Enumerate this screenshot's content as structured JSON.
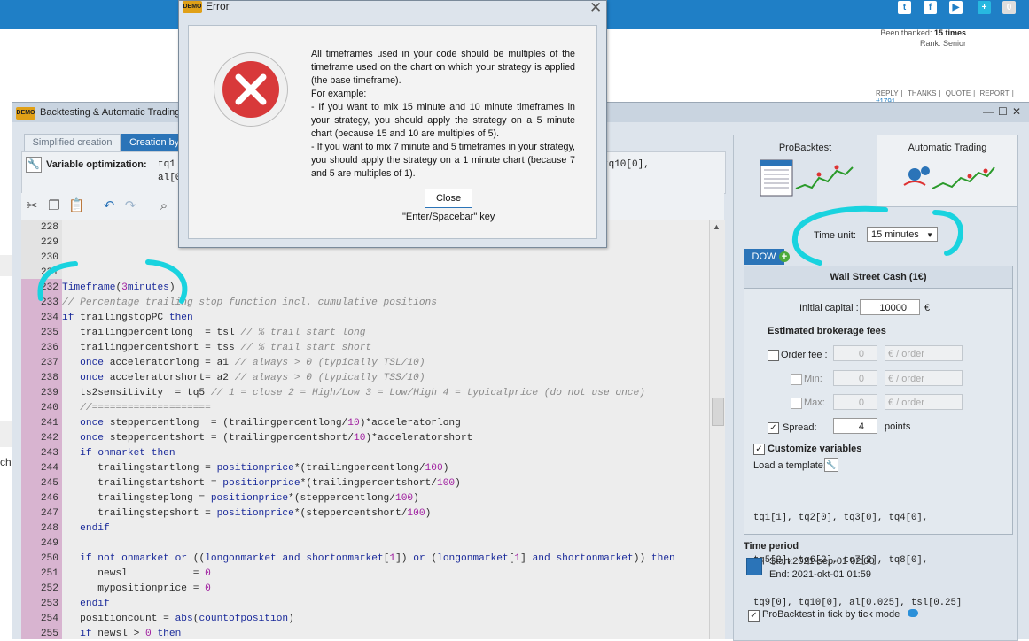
{
  "forum": {
    "been_thanked_label": "Been thanked:",
    "been_thanked_value": "15 times",
    "rank": "Rank: Senior",
    "actions": [
      "REPLY",
      "THANKS",
      "QUOTE",
      "REPORT"
    ],
    "post_id": "#1791",
    "side_text": "ch",
    "notification_count": "0"
  },
  "window": {
    "badge": "DEMO",
    "title": "Backtesting & Automatic Trading"
  },
  "tabs": {
    "simplified": "Simplified creation",
    "creation": "Creation by"
  },
  "var_opt": {
    "label": "Variable optimization:",
    "line1": "tq1",
    "line2": "al[0",
    "line1_tail": "tq10[0],"
  },
  "code_lines": [
    {
      "n": "228",
      "html": ""
    },
    {
      "n": "229",
      "html": ""
    },
    {
      "n": "230",
      "html": ""
    },
    {
      "n": "231",
      "html": ""
    },
    {
      "n": "232",
      "html": "<span class='f'>Timeframe</span>(<span class='n'>3</span><span class='k'>minutes</span>)"
    },
    {
      "n": "233",
      "html": "<span class='c'>// Percentage trailing stop function incl. cumulative positions</span>"
    },
    {
      "n": "234",
      "html": "<span class='k'>if</span> trailingstopPC <span class='k'>then</span>"
    },
    {
      "n": "235",
      "html": "   trailingpercentlong  = tsl <span class='c'>// % trail start long</span>"
    },
    {
      "n": "236",
      "html": "   trailingpercentshort = tss <span class='c'>// % trail start short</span>"
    },
    {
      "n": "237",
      "html": "   <span class='k'>once</span> acceleratorlong = a1 <span class='c'>// always &gt; 0 (typically TSL/10)</span>"
    },
    {
      "n": "238",
      "html": "   <span class='k'>once</span> acceleratorshort= a2 <span class='c'>// always &gt; 0 (typically TSS/10)</span>"
    },
    {
      "n": "239",
      "html": "   ts2sensitivity  = tq5 <span class='c'>// 1 = close 2 = High/Low 3 = Low/High 4 = typicalprice (do not use once)</span>"
    },
    {
      "n": "240",
      "html": "   <span class='c'>//====================</span>"
    },
    {
      "n": "241",
      "html": "   <span class='k'>once</span> steppercentlong  = (trailingpercentlong/<span class='n'>10</span>)*acceleratorlong"
    },
    {
      "n": "242",
      "html": "   <span class='k'>once</span> steppercentshort = (trailingpercentshort/<span class='n'>10</span>)*acceleratorshort"
    },
    {
      "n": "243",
      "html": "   <span class='k'>if</span> <span class='f'>onmarket</span> <span class='k'>then</span>"
    },
    {
      "n": "244",
      "html": "      trailingstartlong = <span class='f'>positionprice</span>*(trailingpercentlong/<span class='n'>100</span>)"
    },
    {
      "n": "245",
      "html": "      trailingstartshort = <span class='f'>positionprice</span>*(trailingpercentshort/<span class='n'>100</span>)"
    },
    {
      "n": "246",
      "html": "      trailingsteplong = <span class='f'>positionprice</span>*(steppercentlong/<span class='n'>100</span>)"
    },
    {
      "n": "247",
      "html": "      trailingstepshort = <span class='f'>positionprice</span>*(steppercentshort/<span class='n'>100</span>)"
    },
    {
      "n": "248",
      "html": "   <span class='k'>endif</span>"
    },
    {
      "n": "249",
      "html": ""
    },
    {
      "n": "250",
      "html": "   <span class='k'>if not</span> <span class='f'>onmarket</span> <span class='k'>or</span> ((<span class='f'>longonmarket</span> <span class='k'>and</span> <span class='f'>shortonmarket</span>[<span class='n'>1</span>]) <span class='k'>or</span> (<span class='f'>longonmarket</span>[<span class='n'>1</span>] <span class='k'>and</span> <span class='f'>shortonmarket</span>)) <span class='k'>then</span>"
    },
    {
      "n": "251",
      "html": "      newsl           = <span class='n'>0</span>"
    },
    {
      "n": "252",
      "html": "      mypositionprice = <span class='n'>0</span>"
    },
    {
      "n": "253",
      "html": "   <span class='k'>endif</span>"
    },
    {
      "n": "254",
      "html": "   positioncount = <span class='f'>abs</span>(<span class='f'>countofposition</span>)"
    },
    {
      "n": "255",
      "html": "   <span class='k'>if</span> newsl &gt; <span class='n'>0</span> <span class='k'>then</span>"
    }
  ],
  "right_panel": {
    "tab_probacktest": "ProBacktest",
    "tab_automatic": "Automatic Trading",
    "time_unit_label": "Time unit:",
    "time_unit_value": "15 minutes",
    "market_tab": "DOW",
    "market_title": "Wall Street Cash (1€)",
    "initial_capital_label": "Initial capital :",
    "initial_capital_value": "10000",
    "currency": "€",
    "fees_heading": "Estimated brokerage fees",
    "order_fee_label": "Order fee :",
    "order_fee_value": "0",
    "order_fee_unit": "€ / order",
    "min_label": "Min:",
    "min_value": "0",
    "min_unit": "€ / order",
    "max_label": "Max:",
    "max_value": "0",
    "max_unit": "€ / order",
    "spread_label": "Spread:",
    "spread_value": "4",
    "spread_unit": "points",
    "customize_label": "Customize variables",
    "load_template_label": "Load a template:",
    "vars_lines": [
      "tq1[1], tq2[0], tq3[0], tq4[0],",
      "tq5[2], tq6[2], tq7[2], tq8[0],",
      "tq9[0], tq10[0], al[0.025], tsl[0.25]"
    ],
    "time_period_label": "Time period",
    "period_start": "Start:2021-sep-01 02:00",
    "period_end": "End:  2021-okt-01 01:59",
    "tick_mode_label": "ProBacktest in tick by tick mode"
  },
  "dialog": {
    "badge": "DEMO",
    "title": "Error",
    "p1": "All timeframes used in your code should be multiples of the timeframe used on the chart on which your strategy is applied (the base timeframe).",
    "p2": "For example:",
    "p3": "- If you want to mix 15 minute and 10 minute timeframes in your strategy, you should apply the strategy on a 5 minute chart (because 15 and 10 are multiples of 5).",
    "p4": "- If you want to mix 7 minute and 5 timeframes in your strategy, you should apply the strategy on a 1 minute chart (because 7 and 5 are multiples of 1).",
    "close_button": "Close",
    "hint": "\"Enter/Spacebar\" key"
  },
  "colors": {
    "accent": "#2b74b8",
    "annotation": "#19d3df",
    "error_red": "#d8393a",
    "topbar": "#1f7fc6"
  }
}
